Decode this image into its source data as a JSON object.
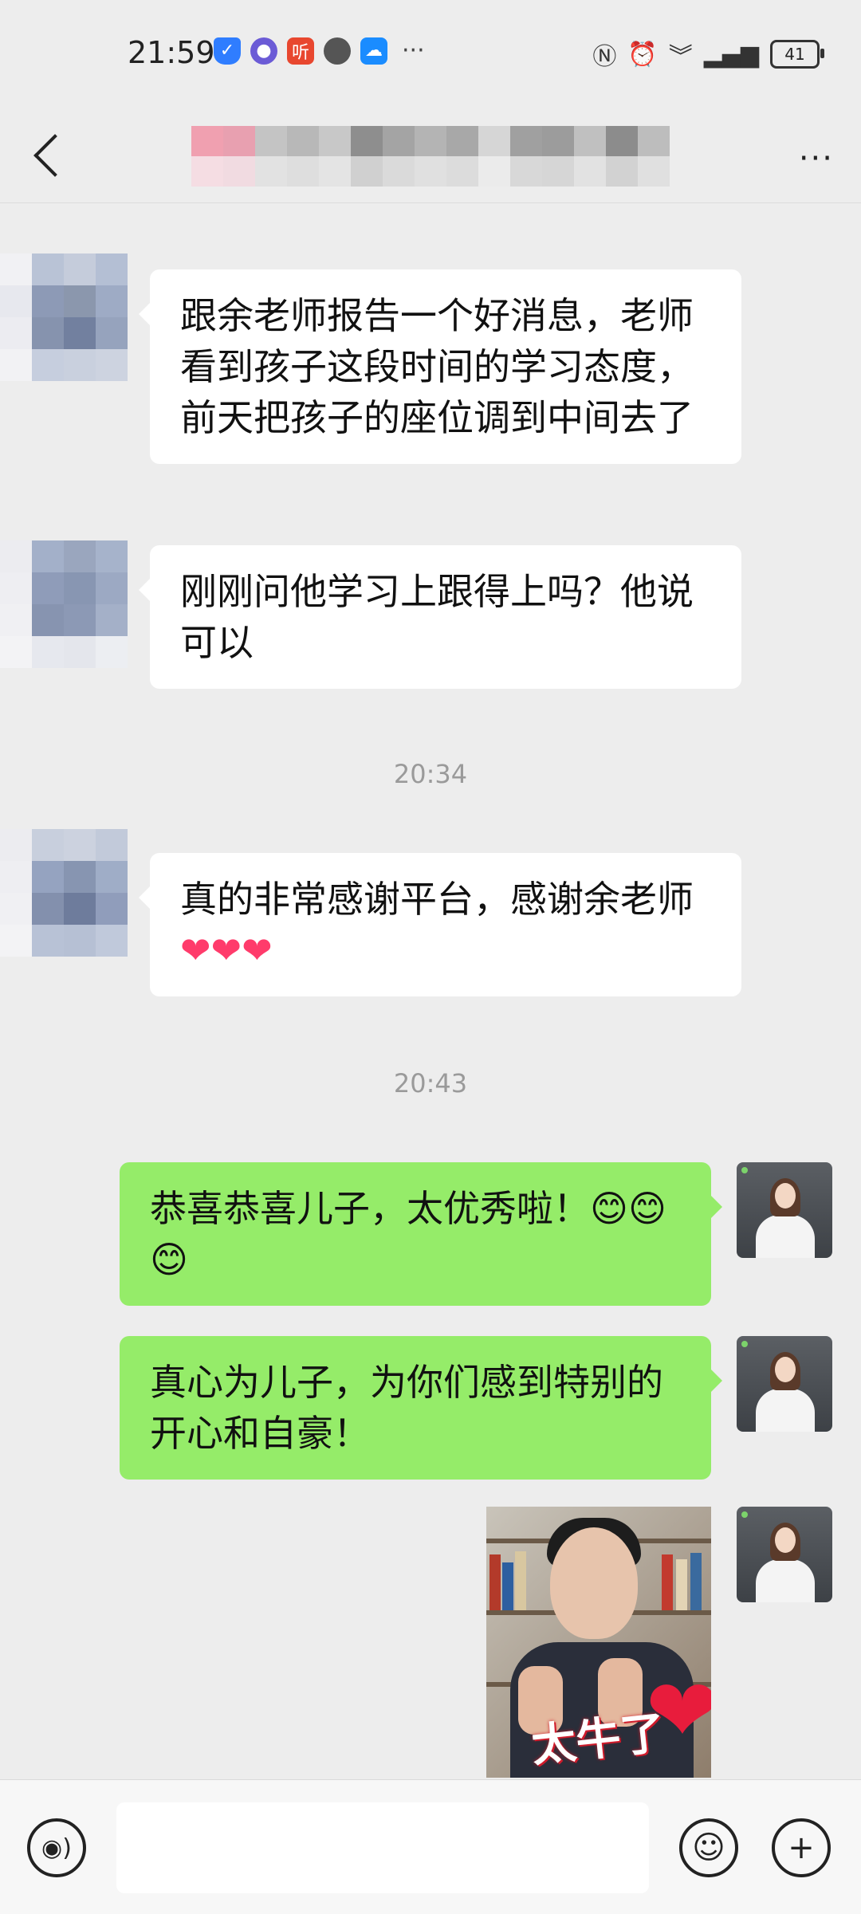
{
  "status_bar": {
    "time": "21:59",
    "left_icons": [
      "shield-icon",
      "app-icon",
      "ting-app-icon",
      "chat-icon",
      "cloud-icon"
    ],
    "ting_label": "听",
    "overflow": "···",
    "battery_level": "41",
    "colors": {
      "shield": "#2f7dff",
      "ting": "#e8472f",
      "cloud": "#1a8cff"
    }
  },
  "header": {
    "more_label": "···"
  },
  "messages": [
    {
      "from": "other",
      "text": "跟余老师报告一个好消息，老师看到孩子这段时间的学习态度，前天把孩子的座位调到中间去了"
    },
    {
      "from": "other",
      "text": "刚刚问他学习上跟得上吗？他说可以"
    },
    {
      "timestamp": "20:34"
    },
    {
      "from": "other",
      "text": "真的非常感谢平台，感谢余老师",
      "suffix": "❤❤❤"
    },
    {
      "timestamp": "20:43"
    },
    {
      "from": "me",
      "text": "恭喜恭喜儿子，太优秀啦！😊😊😊"
    },
    {
      "from": "me",
      "text": "真心为儿子，为你们感到特别的开心和自豪！"
    },
    {
      "from": "me",
      "type": "video",
      "caption": "太牛了"
    }
  ],
  "input_bar": {
    "voice_icon": "voice-icon",
    "emoji_icon": "emoji-icon",
    "plus_icon": "plus-icon",
    "text_value": ""
  }
}
